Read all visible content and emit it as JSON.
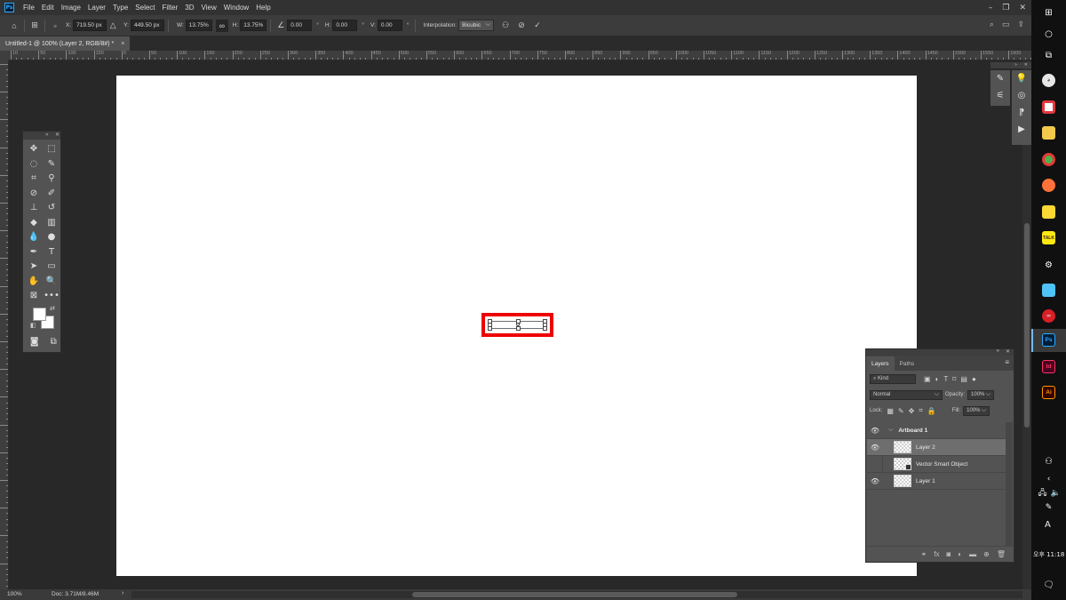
{
  "app": {
    "logo_text": "Ps",
    "accent": "#31a8ff"
  },
  "menu": [
    "File",
    "Edit",
    "Image",
    "Layer",
    "Type",
    "Select",
    "Filter",
    "3D",
    "View",
    "Window",
    "Help"
  ],
  "window_controls": {
    "minimize": "–",
    "restore": "❐",
    "close": "✕"
  },
  "options": {
    "x_label": "X:",
    "x_value": "719.50 px",
    "y_label": "Y:",
    "y_value": "449.50 px",
    "w_label": "W:",
    "w_value": "13.75%",
    "h_label": "H:",
    "h_value": "13.75%",
    "angle_value": "0.00",
    "hskew_label": "H:",
    "hskew_value": "0.00",
    "vskew_label": "V:",
    "vskew_value": "0.00",
    "degree": "°",
    "interpolation_label": "Interpolation:",
    "interpolation_value": "Bicubic"
  },
  "document_tab": {
    "title": "Untitled-1 @ 100% (Layer 2, RGB/8#) *",
    "close": "×"
  },
  "ruler_labels": [
    "10",
    "50",
    "100",
    "150",
    "0",
    "50",
    "100",
    "150",
    "200",
    "250",
    "300",
    "350",
    "400",
    "450",
    "500",
    "550",
    "600",
    "650",
    "700",
    "750",
    "800",
    "850",
    "900",
    "950",
    "1000",
    "1050",
    "1100",
    "1150",
    "1200",
    "1250",
    "1300",
    "1350",
    "1400",
    "1450",
    "1500",
    "1550",
    "1600"
  ],
  "status": {
    "zoom": "100%",
    "doc_size": "Doc: 3.71M/8.46M",
    "arrow": "›"
  },
  "layers_panel": {
    "tabs": [
      "Layers",
      "Paths"
    ],
    "kind_placeholder": "Kind",
    "blend_mode": "Normal",
    "opacity_label": "Opacity:",
    "opacity_value": "100%",
    "lock_label": "Lock:",
    "fill_label": "Fill:",
    "fill_value": "100%",
    "layers": [
      {
        "name": "Artboard 1",
        "type": "artboard",
        "visible": true,
        "selected": false
      },
      {
        "name": "Layer 2",
        "type": "pixel",
        "visible": true,
        "selected": true
      },
      {
        "name": "Vector Smart Object",
        "type": "smart",
        "visible": false,
        "selected": false
      },
      {
        "name": "Layer 1",
        "type": "pixel",
        "visible": true,
        "selected": false
      }
    ]
  },
  "taskbar": {
    "clock": "오후 11:18",
    "ime": "A",
    "apps": [
      {
        "name": "Id",
        "color": "#ff3366",
        "bg": "#49021f"
      },
      {
        "name": "Ai",
        "color": "#ff9a00",
        "bg": "#330000"
      }
    ],
    "active_app": {
      "name": "Ps",
      "color": "#31a8ff",
      "bg": "#001e36"
    }
  },
  "colors": {
    "highlight": "#ee0000",
    "canvas": "#ffffff",
    "foreground": "#ffffff",
    "background": "#ffffff"
  }
}
